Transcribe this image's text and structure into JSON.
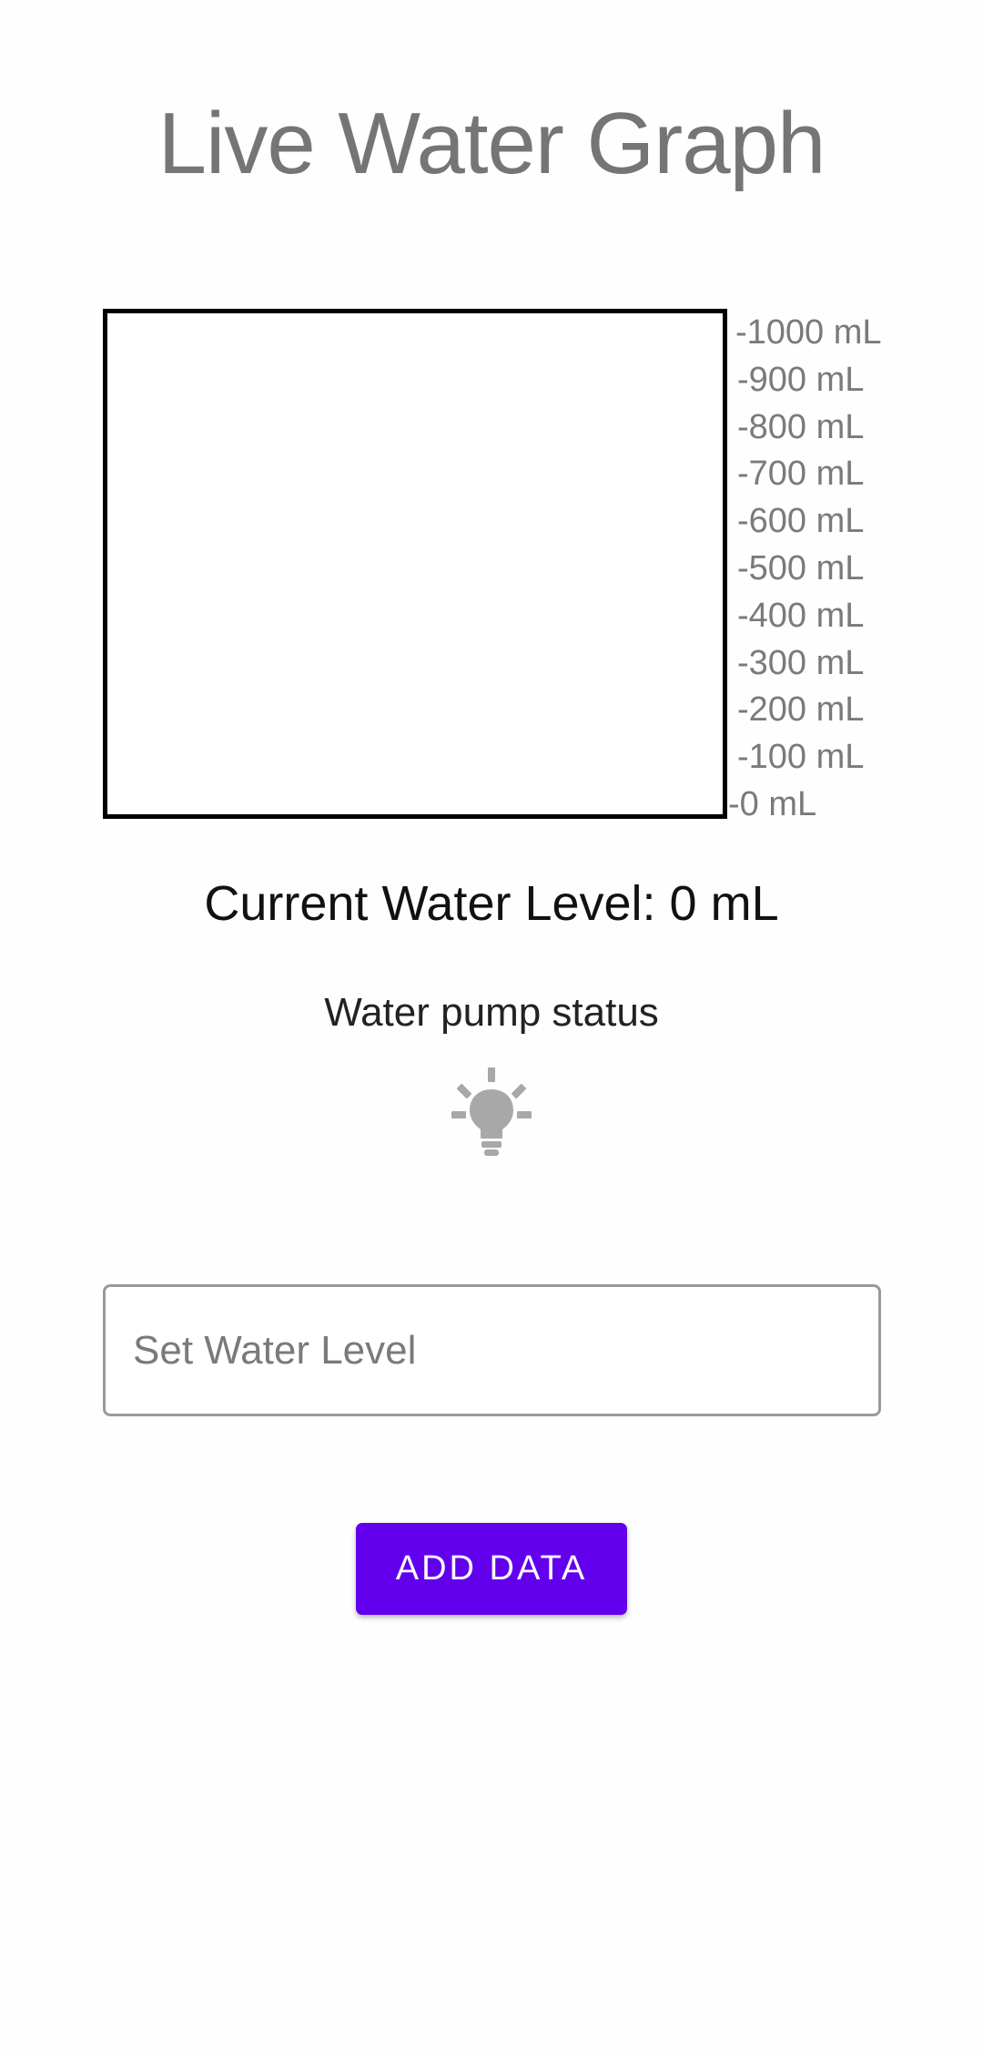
{
  "header": {
    "title": "Live Water Graph"
  },
  "graph": {
    "scale_labels": [
      "-1000 mL",
      "-900 mL",
      "-800 mL",
      "-700 mL",
      "-600 mL",
      "-500 mL",
      "-400 mL",
      "-300 mL",
      "-200 mL",
      "-100 mL",
      "-0 mL"
    ],
    "max_ml": 1000,
    "level_ml": 0,
    "fill_color": "#5fa8e8"
  },
  "status": {
    "current_level_text": "Current Water Level: 0 mL",
    "pump_label": "Water pump status",
    "pump_icon": "lightbulb-icon",
    "pump_state": "off",
    "pump_icon_color": "#a8a8a8"
  },
  "form": {
    "input_placeholder": "Set Water Level",
    "input_value": "",
    "button_label": "ADD DATA",
    "accent_color": "#6200ee"
  }
}
